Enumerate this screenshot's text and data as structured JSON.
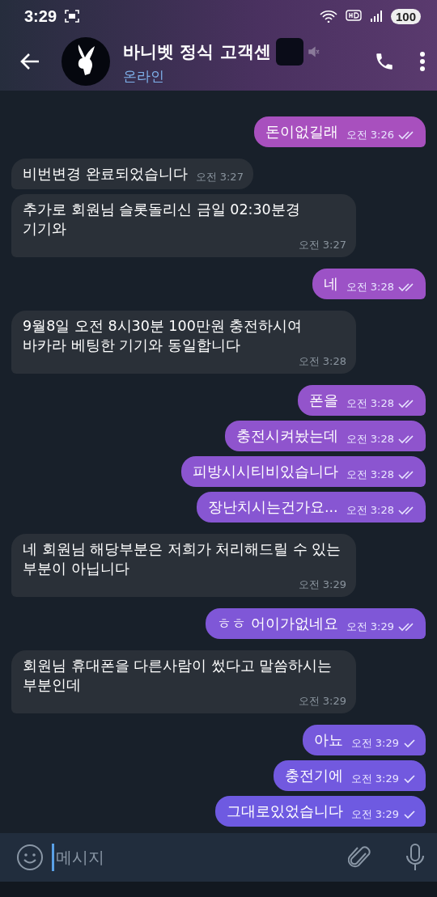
{
  "status_bar": {
    "time": "3:29",
    "battery": "100"
  },
  "header": {
    "title": "바니벳 정식 고객센",
    "status": "온라인",
    "muted": true
  },
  "messages": [
    {
      "kind": "out",
      "text": "돈이없길래",
      "time": "오전 3:26",
      "read": true
    },
    {
      "kind": "in",
      "text": "비번변경 완료되었습니다",
      "time": "오전 3:27"
    },
    {
      "kind": "in",
      "text": "추가로 회원님 슬롯돌리신 금일 02:30분경 기기와",
      "time": "오전 3:27"
    },
    {
      "kind": "out",
      "text": "네",
      "time": "오전 3:28",
      "read": true
    },
    {
      "kind": "in",
      "text": "9월8일 오전 8시30분 100만원 충전하시여 바카라 베팅한 기기와 동일합니다",
      "time": "오전 3:28"
    },
    {
      "kind": "out",
      "text": "폰을",
      "time": "오전 3:28",
      "read": true
    },
    {
      "kind": "out",
      "text": "충전시켜놨는데",
      "time": "오전 3:28",
      "read": true
    },
    {
      "kind": "out",
      "text": "피방시시티비있습니다",
      "time": "오전 3:28",
      "read": true
    },
    {
      "kind": "out",
      "text": "장난치시는건가요...",
      "time": "오전 3:28",
      "read": true
    },
    {
      "kind": "in",
      "text": "네 회원님 해당부분은 저희가 처리해드릴 수 있는 부분이 아닙니다",
      "time": "오전 3:29"
    },
    {
      "kind": "out",
      "text": "ㅎㅎ 어이가없네요",
      "time": "오전 3:29",
      "read": true
    },
    {
      "kind": "in",
      "text": "회원님 휴대폰을 다른사람이 썼다고 말씀하시는 부분인데",
      "time": "오전 3:29"
    },
    {
      "kind": "out",
      "text": "아뇨",
      "time": "오전 3:29",
      "read": false
    },
    {
      "kind": "out",
      "text": "충전기에",
      "time": "오전 3:29",
      "read": false
    },
    {
      "kind": "out",
      "text": "그대로있었습니다",
      "time": "오전 3:29",
      "read": false
    }
  ],
  "composer": {
    "placeholder": "메시지"
  }
}
